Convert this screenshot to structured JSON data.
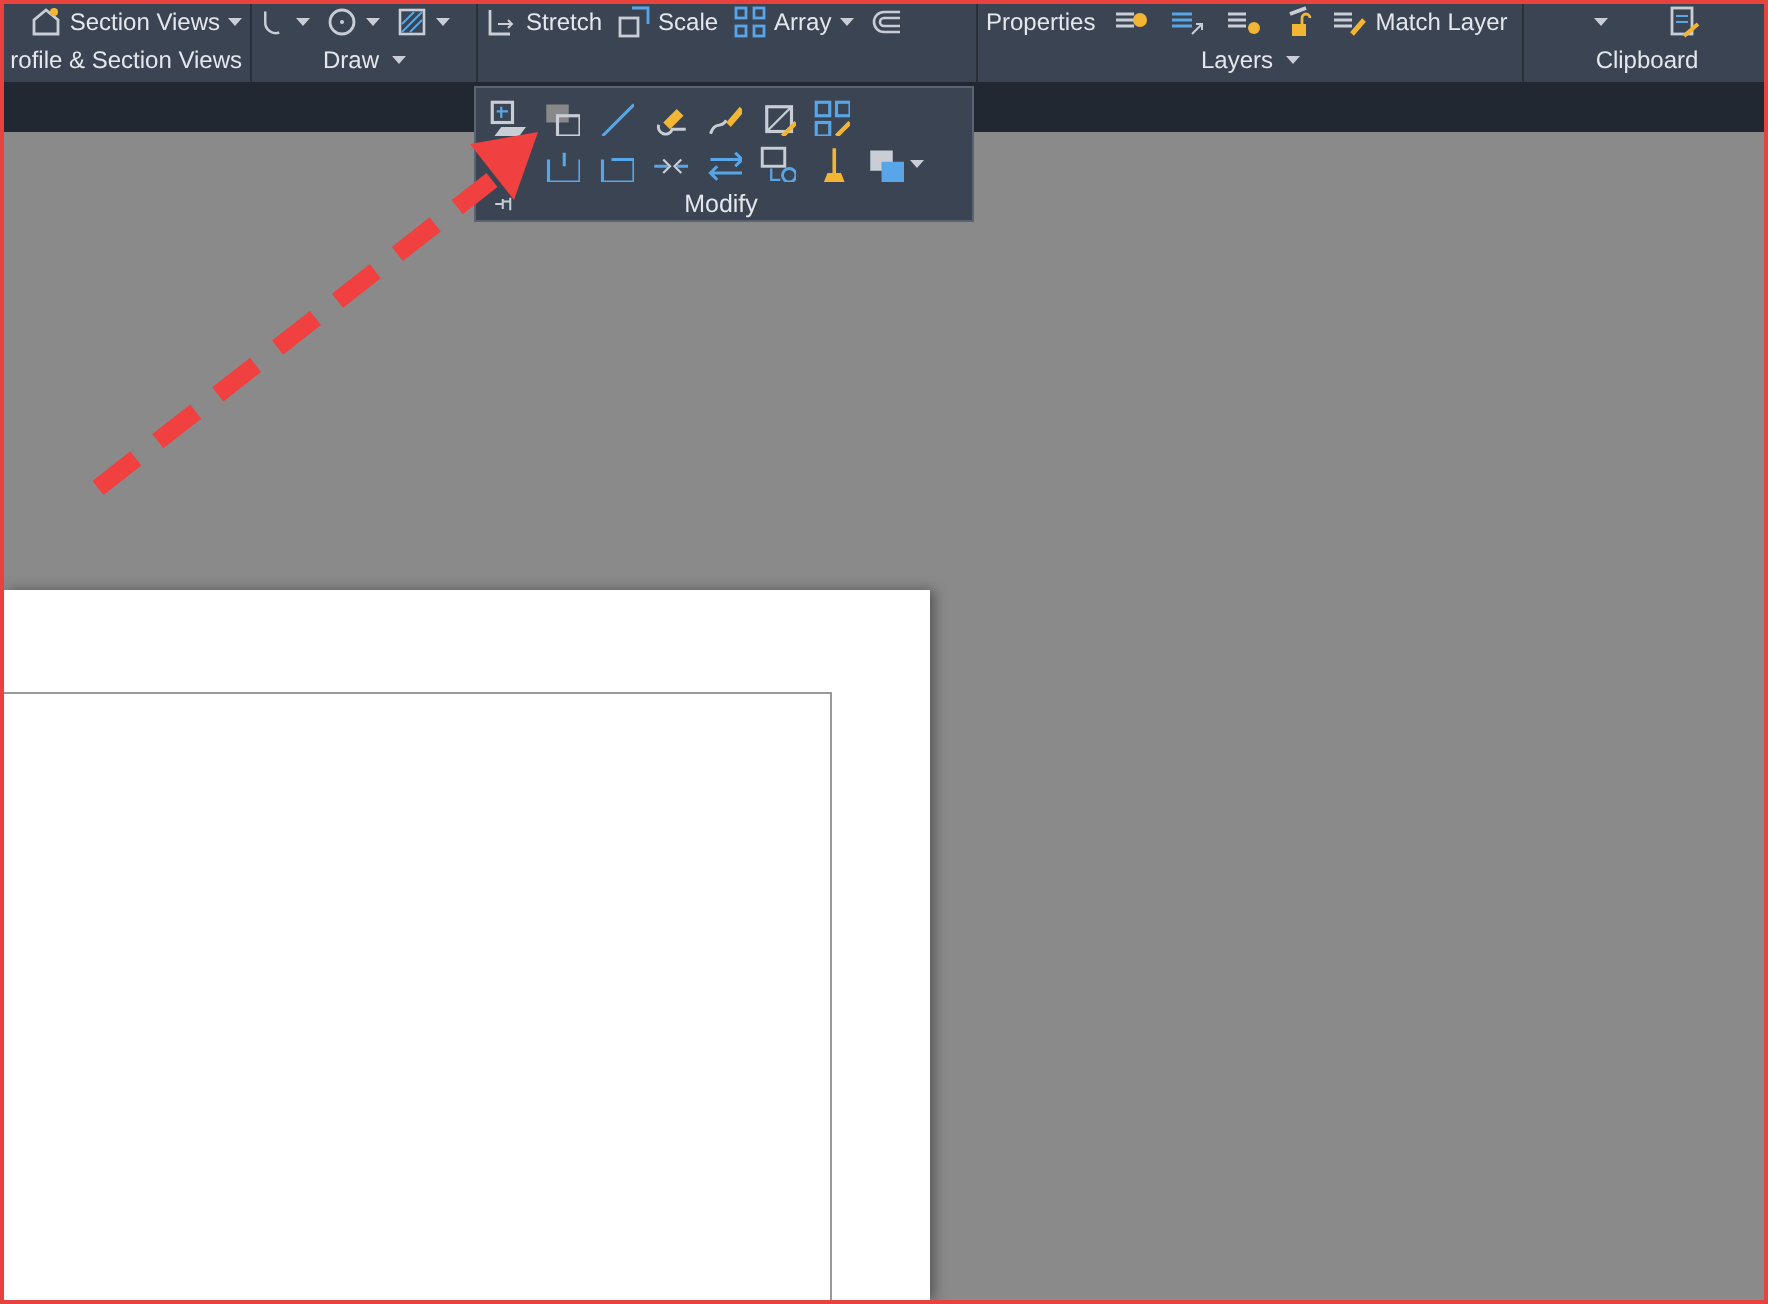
{
  "ribbon": {
    "panels": [
      {
        "title": "rofile & Section Views",
        "title_dropdown": false,
        "tools": [
          {
            "label": "Section Views",
            "dropdown": true
          }
        ]
      },
      {
        "title": "Draw",
        "title_dropdown": true,
        "tools": [
          {
            "dropdown": true
          },
          {
            "dropdown": true
          },
          {
            "dropdown": true
          }
        ]
      },
      {
        "tools": [
          {
            "label": "Stretch",
            "dropdown": false
          },
          {
            "label": "Scale",
            "dropdown": false
          },
          {
            "label": "Array",
            "dropdown": true
          },
          {
            "dropdown": false
          }
        ]
      },
      {
        "title": "Layers",
        "title_dropdown": true,
        "tools": [
          {
            "label": "Properties",
            "dropdown": false
          },
          {
            "dropdown": false
          },
          {
            "dropdown": false
          },
          {
            "dropdown": false
          },
          {
            "dropdown": false
          },
          {
            "label": "Match Layer",
            "dropdown": false
          }
        ]
      },
      {
        "title": "Clipboard",
        "title_dropdown": false,
        "tools": [
          {
            "dropdown": true
          },
          {
            "dropdown": false
          }
        ]
      }
    ]
  },
  "modify_panel": {
    "title": "Modify",
    "rows": [
      {
        "tools": [
          {
            "dropdown": false
          },
          {
            "dropdown": false
          },
          {
            "dropdown": false
          },
          {
            "dropdown": false
          },
          {
            "dropdown": false
          },
          {
            "dropdown": false
          },
          {
            "dropdown": false
          }
        ]
      },
      {
        "tools": [
          {
            "dropdown": false
          },
          {
            "dropdown": false
          },
          {
            "dropdown": false
          },
          {
            "dropdown": false
          },
          {
            "dropdown": false
          },
          {
            "dropdown": false
          },
          {
            "dropdown": true
          }
        ]
      }
    ]
  }
}
